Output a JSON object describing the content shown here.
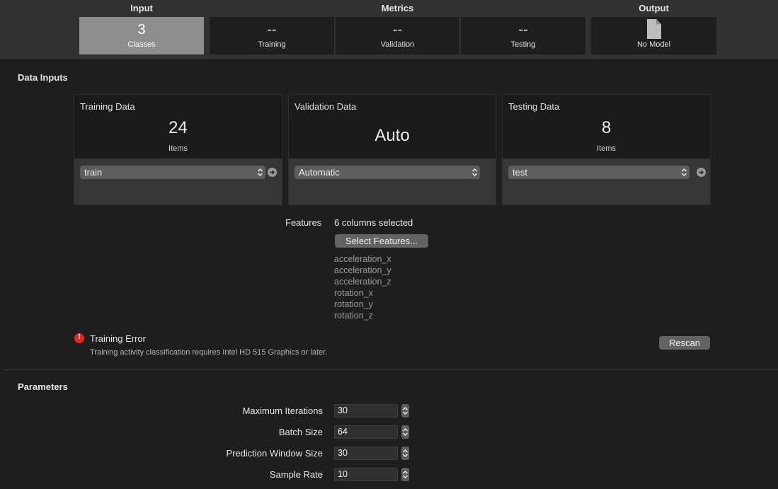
{
  "header": {
    "input_label": "Input",
    "metrics_label": "Metrics",
    "output_label": "Output",
    "classes": {
      "value": "3",
      "label": "Classes"
    },
    "training": {
      "value": "--",
      "label": "Training"
    },
    "validation": {
      "value": "--",
      "label": "Validation"
    },
    "testing": {
      "value": "--",
      "label": "Testing"
    },
    "output": {
      "icon": "document-icon",
      "label": "No Model"
    }
  },
  "data_inputs": {
    "heading": "Data Inputs",
    "training": {
      "title": "Training Data",
      "count": "24",
      "count_label": "Items",
      "source": "train"
    },
    "validation": {
      "title": "Validation Data",
      "count": "Auto",
      "source": "Automatic"
    },
    "testing": {
      "title": "Testing Data",
      "count": "8",
      "count_label": "Items",
      "source": "test"
    }
  },
  "features": {
    "label": "Features",
    "summary": "6 columns selected",
    "select_button": "Select Features...",
    "columns": [
      "acceleration_x",
      "acceleration_y",
      "acceleration_z",
      "rotation_x",
      "rotation_y",
      "rotation_z"
    ]
  },
  "error": {
    "icon": "exclamation-icon",
    "color": "#e5251f",
    "title": "Training Error",
    "message": "Training activity classification requires Intel HD 515 Graphics or later.",
    "rescan_button": "Rescan"
  },
  "parameters": {
    "heading": "Parameters",
    "items": [
      {
        "label": "Maximum Iterations",
        "value": "30"
      },
      {
        "label": "Batch Size",
        "value": "64"
      },
      {
        "label": "Prediction Window Size",
        "value": "30"
      },
      {
        "label": "Sample Rate",
        "value": "10"
      }
    ]
  }
}
